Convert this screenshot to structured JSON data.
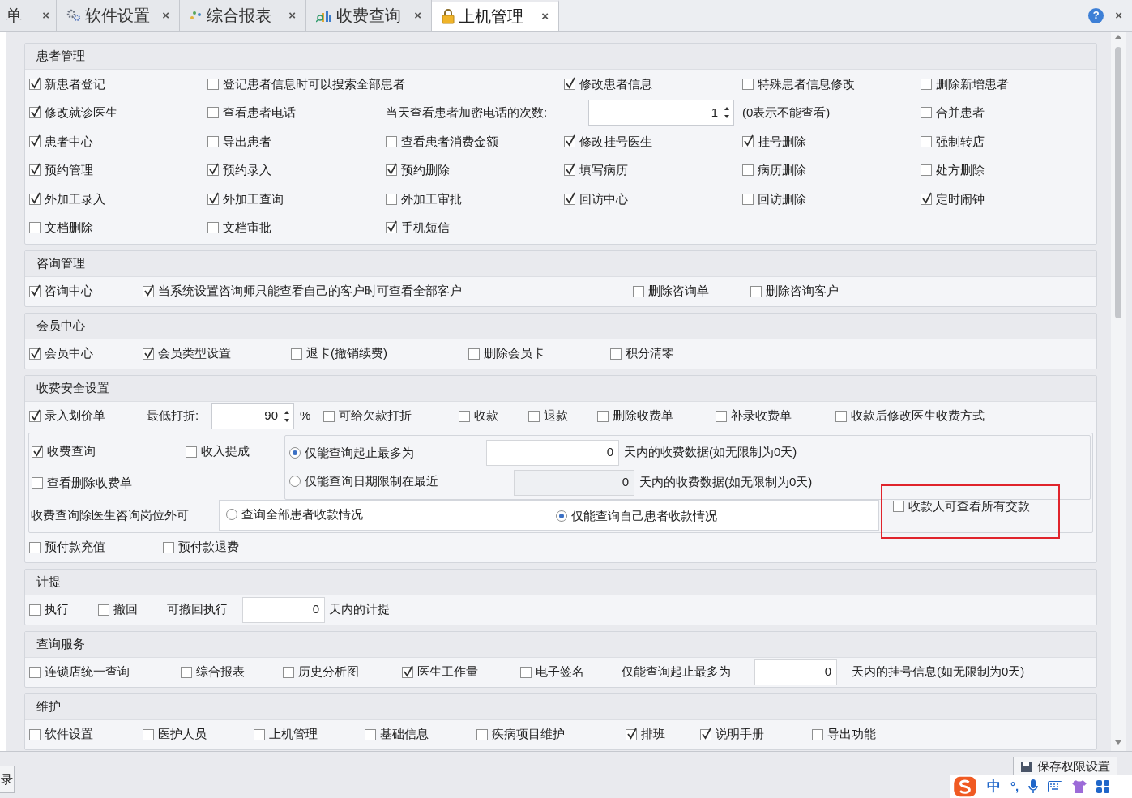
{
  "tabs": [
    {
      "label": "单",
      "selected": false
    },
    {
      "label": "软件设置",
      "selected": false
    },
    {
      "label": "综合报表",
      "selected": false
    },
    {
      "label": "收费查询",
      "selected": false
    },
    {
      "label": "上机管理",
      "selected": true
    }
  ],
  "tab_close": "×",
  "help": "?",
  "window_close": "×",
  "sections": [
    {
      "title": "患者管理",
      "rows": [
        [
          {
            "kind": "checkbox",
            "label": "新患者登记",
            "checked": true
          },
          {
            "kind": "checkbox",
            "label": "登记患者信息时可以搜索全部患者",
            "checked": false
          },
          "",
          {
            "kind": "checkbox",
            "label": "修改患者信息",
            "checked": true
          },
          {
            "kind": "checkbox",
            "label": "特殊患者信息修改",
            "checked": false
          },
          {
            "kind": "checkbox",
            "label": "删除新增患者",
            "checked": false
          }
        ],
        [
          {
            "kind": "checkbox",
            "label": "修改就诊医生",
            "checked": true
          },
          {
            "kind": "checkbox",
            "label": "查看患者电话",
            "checked": false
          },
          {
            "kind": "text",
            "label": "当天查看患者加密电话的次数:"
          },
          {
            "kind": "spin",
            "value": "1"
          },
          {
            "kind": "text",
            "label": "(0表示不能查看)"
          },
          {
            "kind": "checkbox",
            "label": "合并患者",
            "checked": false
          }
        ],
        [
          {
            "kind": "checkbox",
            "label": "患者中心",
            "checked": true
          },
          {
            "kind": "checkbox",
            "label": "导出患者",
            "checked": false
          },
          {
            "kind": "checkbox",
            "label": "查看患者消费金额",
            "checked": false
          },
          {
            "kind": "checkbox",
            "label": "修改挂号医生",
            "checked": true
          },
          {
            "kind": "checkbox",
            "label": "挂号删除",
            "checked": true
          },
          {
            "kind": "checkbox",
            "label": "强制转店",
            "checked": false
          }
        ],
        [
          {
            "kind": "checkbox",
            "label": "预约管理",
            "checked": true
          },
          {
            "kind": "checkbox",
            "label": "预约录入",
            "checked": true
          },
          {
            "kind": "checkbox",
            "label": "预约删除",
            "checked": true
          },
          {
            "kind": "checkbox",
            "label": "填写病历",
            "checked": true
          },
          {
            "kind": "checkbox",
            "label": "病历删除",
            "checked": false
          },
          {
            "kind": "checkbox",
            "label": "处方删除",
            "checked": false
          }
        ],
        [
          {
            "kind": "checkbox",
            "label": "外加工录入",
            "checked": true
          },
          {
            "kind": "checkbox",
            "label": "外加工查询",
            "checked": true
          },
          {
            "kind": "checkbox",
            "label": "外加工审批",
            "checked": false
          },
          {
            "kind": "checkbox",
            "label": "回访中心",
            "checked": true
          },
          {
            "kind": "checkbox",
            "label": "回访删除",
            "checked": false
          },
          {
            "kind": "checkbox",
            "label": "定时闹钟",
            "checked": true
          }
        ],
        [
          {
            "kind": "checkbox",
            "label": "文档删除",
            "checked": false
          },
          {
            "kind": "checkbox",
            "label": "文档审批",
            "checked": false
          },
          {
            "kind": "checkbox",
            "label": "手机短信",
            "checked": true
          }
        ]
      ]
    },
    {
      "title": "咨询管理",
      "rows": [
        [
          {
            "kind": "checkbox",
            "label": "咨询中心",
            "checked": true
          },
          {
            "kind": "checkbox",
            "label": "当系统设置咨询师只能查看自己的客户时可查看全部客户",
            "checked": true
          },
          {
            "kind": "checkbox",
            "label": "删除咨询单",
            "checked": false
          },
          {
            "kind": "checkbox",
            "label": "删除咨询客户",
            "checked": false
          }
        ]
      ]
    },
    {
      "title": "会员中心",
      "rows": [
        [
          {
            "kind": "checkbox",
            "label": "会员中心",
            "checked": true
          },
          {
            "kind": "checkbox",
            "label": "会员类型设置",
            "checked": true
          },
          {
            "kind": "checkbox",
            "label": "退卡(撤销续费)",
            "checked": false
          },
          {
            "kind": "checkbox",
            "label": "删除会员卡",
            "checked": false
          },
          {
            "kind": "checkbox",
            "label": "积分清零",
            "checked": false
          }
        ]
      ]
    },
    {
      "title": "收费安全设置",
      "rows": [
        [
          {
            "kind": "checkbox",
            "label": "录入划价单",
            "checked": true
          },
          {
            "kind": "text",
            "label": "最低打折:"
          },
          {
            "kind": "spin",
            "value": "90"
          },
          {
            "kind": "text",
            "label": "%"
          },
          {
            "kind": "checkbox",
            "label": "可给欠款打折",
            "checked": false
          },
          {
            "kind": "checkbox",
            "label": "收款",
            "checked": false
          },
          {
            "kind": "checkbox",
            "label": "退款",
            "checked": false
          },
          {
            "kind": "checkbox",
            "label": "删除收费单",
            "checked": false
          },
          {
            "kind": "checkbox",
            "label": "补录收费单",
            "checked": false
          },
          {
            "kind": "checkbox",
            "label": "收款后修改医生收费方式",
            "checked": false
          }
        ]
      ],
      "charge_query": {
        "options": [
          {
            "label": "收费查询",
            "checked": true
          },
          {
            "label": "收入提成",
            "checked": false
          },
          {
            "label": "查看删除收费单",
            "checked": false
          }
        ],
        "limits": [
          {
            "label": "仅能查询起止最多为",
            "selected": true,
            "value": "0",
            "disabled": false,
            "suffix": "天内的收费数据(如无限制为0天)"
          },
          {
            "label": "仅能查询日期限制在最近",
            "selected": false,
            "value": "0",
            "disabled": true,
            "suffix": "天内的收费数据(如无限制为0天)"
          }
        ],
        "scope_label": "收费查询除医生咨询岗位外可",
        "scope_options": [
          {
            "label": "查询全部患者收款情况",
            "selected": false
          },
          {
            "label": "仅能查询自己患者收款情况",
            "selected": true
          }
        ],
        "cashier_option": {
          "label": "收款人可查看所有交款",
          "checked": false,
          "highlighted": true
        }
      },
      "rows_after": [
        [
          {
            "kind": "checkbox",
            "label": "预付款充值",
            "checked": false
          },
          {
            "kind": "checkbox",
            "label": "预付款退费",
            "checked": false
          }
        ]
      ]
    },
    {
      "title": "计提",
      "rows": [
        [
          {
            "kind": "checkbox",
            "label": "执行",
            "checked": false
          },
          {
            "kind": "checkbox",
            "label": "撤回",
            "checked": false
          },
          {
            "kind": "text",
            "label": "可撤回执行"
          },
          {
            "kind": "field",
            "value": "0"
          },
          {
            "kind": "text",
            "label": "天内的计提"
          }
        ]
      ]
    },
    {
      "title": "查询服务",
      "rows": [
        [
          {
            "kind": "checkbox",
            "label": "连锁店统一查询",
            "checked": false
          },
          {
            "kind": "checkbox",
            "label": "综合报表",
            "checked": false
          },
          {
            "kind": "checkbox",
            "label": "历史分析图",
            "checked": false
          },
          {
            "kind": "checkbox",
            "label": "医生工作量",
            "checked": true
          },
          {
            "kind": "checkbox",
            "label": "电子签名",
            "checked": false
          },
          {
            "kind": "text",
            "label": "仅能查询起止最多为"
          },
          {
            "kind": "field",
            "value": "0"
          },
          {
            "kind": "text",
            "label": "天内的挂号信息(如无限制为0天)"
          }
        ]
      ]
    },
    {
      "title": "维护",
      "rows": [
        [
          {
            "kind": "checkbox",
            "label": "软件设置",
            "checked": false
          },
          {
            "kind": "checkbox",
            "label": "医护人员",
            "checked": false
          },
          {
            "kind": "checkbox",
            "label": "上机管理",
            "checked": false
          },
          {
            "kind": "checkbox",
            "label": "基础信息",
            "checked": false
          },
          {
            "kind": "checkbox",
            "label": "疾病项目维护",
            "checked": false
          },
          {
            "kind": "checkbox",
            "label": "排班",
            "checked": true
          },
          {
            "kind": "checkbox",
            "label": "说明手册",
            "checked": true
          },
          {
            "kind": "checkbox",
            "label": "导出功能",
            "checked": false
          }
        ]
      ]
    }
  ],
  "bottom": {
    "left_button": "录",
    "save_button": "保存权限设置"
  },
  "ime": {
    "mode": "中",
    "punct": "°,"
  }
}
